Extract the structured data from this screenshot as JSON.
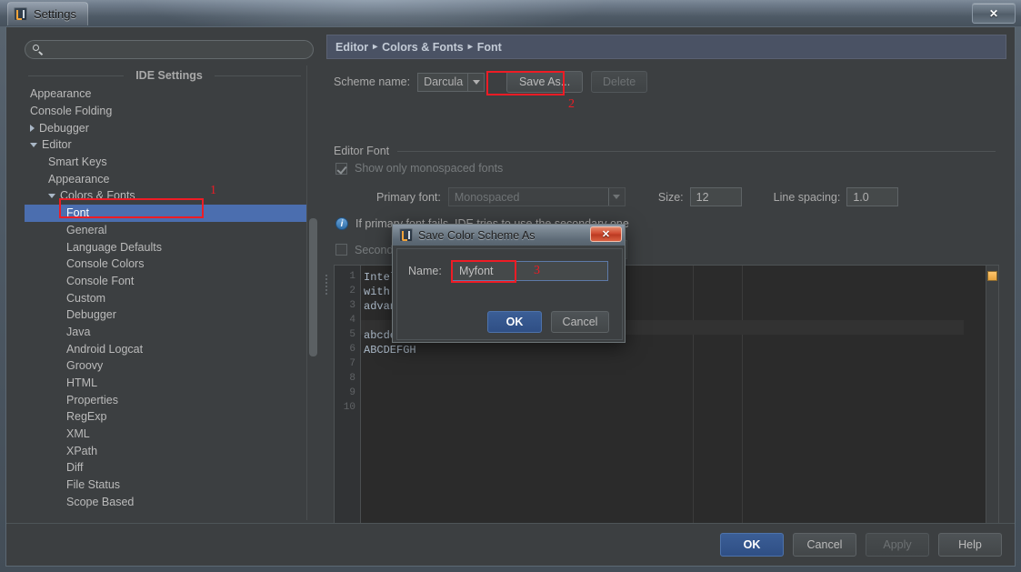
{
  "window": {
    "title": "Settings",
    "close_label": "✕",
    "app_icon": "intellij-logo-icon"
  },
  "sidebar": {
    "search": {
      "value": "",
      "placeholder": "",
      "icon": "search-icon"
    },
    "section_title": "IDE Settings",
    "tree": [
      {
        "label": "Appearance",
        "indent": 0,
        "arrow": "none",
        "selected": false
      },
      {
        "label": "Console Folding",
        "indent": 0,
        "arrow": "none",
        "selected": false
      },
      {
        "label": "Debugger",
        "indent": 0,
        "arrow": "closed",
        "selected": false
      },
      {
        "label": "Editor",
        "indent": 0,
        "arrow": "open",
        "selected": false
      },
      {
        "label": "Smart Keys",
        "indent": 1,
        "arrow": "none",
        "selected": false
      },
      {
        "label": "Appearance",
        "indent": 1,
        "arrow": "none",
        "selected": false
      },
      {
        "label": "Colors & Fonts",
        "indent": 1,
        "arrow": "open",
        "selected": false
      },
      {
        "label": "Font",
        "indent": 2,
        "arrow": "none",
        "selected": true
      },
      {
        "label": "General",
        "indent": 2,
        "arrow": "none",
        "selected": false
      },
      {
        "label": "Language Defaults",
        "indent": 2,
        "arrow": "none",
        "selected": false
      },
      {
        "label": "Console Colors",
        "indent": 2,
        "arrow": "none",
        "selected": false
      },
      {
        "label": "Console Font",
        "indent": 2,
        "arrow": "none",
        "selected": false
      },
      {
        "label": "Custom",
        "indent": 2,
        "arrow": "none",
        "selected": false
      },
      {
        "label": "Debugger",
        "indent": 2,
        "arrow": "none",
        "selected": false
      },
      {
        "label": "Java",
        "indent": 2,
        "arrow": "none",
        "selected": false
      },
      {
        "label": "Android Logcat",
        "indent": 2,
        "arrow": "none",
        "selected": false
      },
      {
        "label": "Groovy",
        "indent": 2,
        "arrow": "none",
        "selected": false
      },
      {
        "label": "HTML",
        "indent": 2,
        "arrow": "none",
        "selected": false
      },
      {
        "label": "Properties",
        "indent": 2,
        "arrow": "none",
        "selected": false
      },
      {
        "label": "RegExp",
        "indent": 2,
        "arrow": "none",
        "selected": false
      },
      {
        "label": "XML",
        "indent": 2,
        "arrow": "none",
        "selected": false
      },
      {
        "label": "XPath",
        "indent": 2,
        "arrow": "none",
        "selected": false
      },
      {
        "label": "Diff",
        "indent": 2,
        "arrow": "none",
        "selected": false
      },
      {
        "label": "File Status",
        "indent": 2,
        "arrow": "none",
        "selected": false
      },
      {
        "label": "Scope Based",
        "indent": 2,
        "arrow": "none",
        "selected": false
      }
    ]
  },
  "main": {
    "breadcrumb": [
      "Editor",
      "Colors & Fonts",
      "Font"
    ],
    "breadcrumb_separator": "▸",
    "scheme": {
      "label": "Scheme name:",
      "value": "Darcula",
      "save_as_label": "Save As...",
      "delete_label": "Delete"
    },
    "editor_font": {
      "group_label": "Editor Font",
      "monospaced_label": "Show only monospaced fonts",
      "monospaced_checked": true,
      "primary_font_label": "Primary font:",
      "primary_font_value": "Monospaced",
      "size_label": "Size:",
      "size_value": "12",
      "line_spacing_label": "Line spacing:",
      "line_spacing_value": "1.0",
      "info_text": "If primary font fails, IDE tries to use the secondary one",
      "info_icon": "info-icon",
      "secondary_font_label": "Secondary font:",
      "secondary_font_value": "",
      "secondary_checked": false
    },
    "preview": {
      "line_numbers": [
        "1",
        "2",
        "3",
        "4",
        "5",
        "6",
        "7",
        "8",
        "9",
        "10"
      ],
      "lines": [
        "Intelli",
        "with a l",
        "advanced",
        "",
        "abcdefgh",
        "ABCDEFGH",
        "",
        "",
        "",
        ""
      ],
      "marker_color": "#ffc66d"
    }
  },
  "dialog": {
    "title": "Save Color Scheme As",
    "icon": "intellij-logo-icon",
    "close_label": "✕",
    "name_label": "Name:",
    "name_value": "Myfont",
    "ok_label": "OK",
    "cancel_label": "Cancel"
  },
  "footer": {
    "ok_label": "OK",
    "cancel_label": "Cancel",
    "apply_label": "Apply",
    "help_label": "Help"
  },
  "annotations": {
    "accent_color": "#ee1c25",
    "markers": [
      {
        "number": "1",
        "target": "font-tree-item"
      },
      {
        "number": "2",
        "target": "save-as-button"
      },
      {
        "number": "3",
        "target": "dialog-name-field"
      }
    ]
  }
}
